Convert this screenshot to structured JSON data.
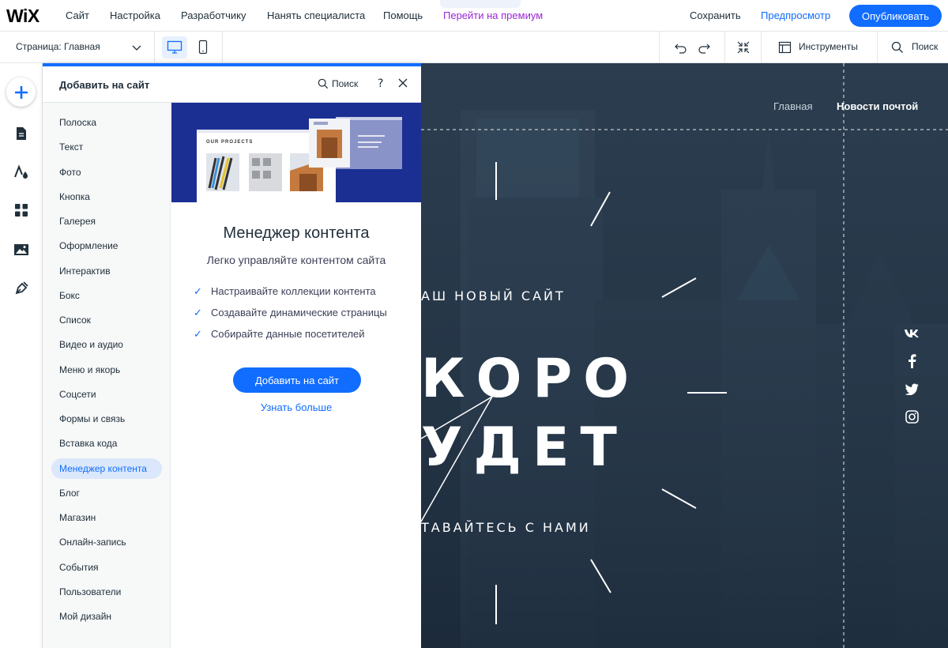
{
  "topbar": {
    "logo": "WiX",
    "menu": [
      "Сайт",
      "Настройка",
      "Разработчику",
      "Нанять специалиста",
      "Помощь",
      "Перейти на премиум"
    ],
    "collapse_glyph": "⌃",
    "save_label": "Сохранить",
    "preview_label": "Предпросмотр",
    "publish_label": "Опубликовать"
  },
  "subbar": {
    "page_select": "Страница: Главная",
    "tools_label": "Инструменты",
    "search_label": "Поиск"
  },
  "rail": {
    "icons": [
      "add-icon",
      "pages-icon",
      "design-icon",
      "apps-icon",
      "media-icon",
      "blog-pen-icon"
    ]
  },
  "panel": {
    "title": "Добавить на сайт",
    "search_label": "Поиск",
    "help_glyph": "?",
    "categories": [
      "Полоска",
      "Текст",
      "Фото",
      "Кнопка",
      "Галерея",
      "Оформление",
      "Интерактив",
      "Бокс",
      "Список",
      "Видео и аудио",
      "Меню и якорь",
      "Соцсети",
      "Формы и связь",
      "Вставка кода",
      "Менеджер контента",
      "Блог",
      "Магазин",
      "Онлайн-запись",
      "События",
      "Пользователи",
      "Мой дизайн"
    ],
    "selected_category": "Менеджер контента",
    "detail": {
      "image_caption": "OUR PROJECTS",
      "title": "Менеджер контента",
      "subtitle": "Легко управляйте контентом сайта",
      "features": [
        "Настраивайте коллекции контента",
        "Создавайте динамические страницы",
        "Собирайте данные посетителей"
      ],
      "cta": "Добавить на сайт",
      "link": "Узнать больше"
    }
  },
  "canvas": {
    "nav": [
      "Главная",
      "Новости почтой"
    ],
    "kicker": "АШ НОВЫЙ САЙТ",
    "big_line1": "КОРО",
    "big_line2": "УДЕТ",
    "follow": "ТАВАЙТЕСЬ С НАМИ",
    "social": [
      "vk-icon",
      "facebook-icon",
      "twitter-icon",
      "instagram-icon"
    ]
  },
  "colors": {
    "accent": "#116dff",
    "premium": "#9a27d5",
    "canvas_bg": "#263748"
  }
}
